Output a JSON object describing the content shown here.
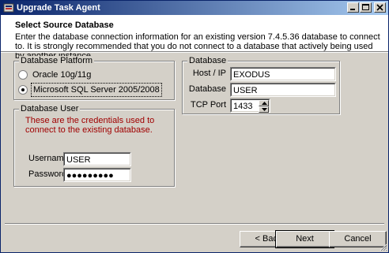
{
  "window": {
    "title": "Upgrade Task Agent",
    "controls": [
      "minimize",
      "maximize",
      "close"
    ]
  },
  "header": {
    "title": "Select Source Database",
    "description": "Enter the database connection information for an existing version 7.4.5.36 database to connect to.  It is strongly recommended that you do not connect to a database that actively being used by another instance."
  },
  "platform": {
    "legend": "Database Platform",
    "options": [
      {
        "label": "Oracle 10g/11g",
        "selected": false
      },
      {
        "label": "Microsoft SQL Server 2005/2008",
        "selected": true
      }
    ]
  },
  "database": {
    "legend": "Database",
    "host_label": "Host / IP",
    "host_value": "EXODUS",
    "db_label": "Database",
    "db_value": "USER",
    "port_label": "TCP Port",
    "port_value": "1433"
  },
  "user": {
    "legend": "Database User",
    "note": "These are the credentials used to connect to the existing database.",
    "username_label": "Username",
    "username_value": "USER",
    "password_label": "Password",
    "password_value": "●●●●●●●●●"
  },
  "buttons": {
    "back": "< Back",
    "next": "Next",
    "cancel": "Cancel"
  },
  "colors": {
    "title_gradient_start": "#0a246a",
    "title_gradient_end": "#a6caf0",
    "face": "#d4d0c8",
    "note_text": "#a00000"
  }
}
